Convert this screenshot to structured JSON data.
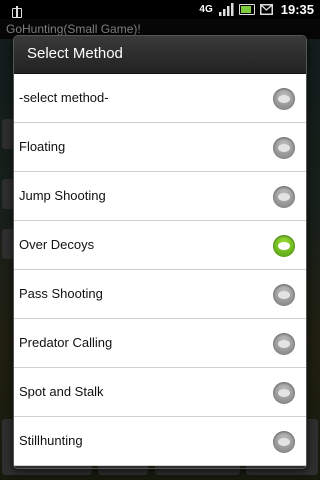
{
  "status_bar": {
    "network": "4G",
    "time": "19:35",
    "battery_level": 0.7
  },
  "background": {
    "app_title": "GoHunting(Small Game)!"
  },
  "dialog": {
    "title": "Select Method",
    "options": [
      {
        "label": "-select method-",
        "selected": false
      },
      {
        "label": "Floating",
        "selected": false
      },
      {
        "label": "Jump Shooting",
        "selected": false
      },
      {
        "label": "Over Decoys",
        "selected": true
      },
      {
        "label": "Pass Shooting",
        "selected": false
      },
      {
        "label": "Predator Calling",
        "selected": false
      },
      {
        "label": "Spot and Stalk",
        "selected": false
      },
      {
        "label": "Stillhunting",
        "selected": false
      }
    ]
  },
  "colors": {
    "selected_radio": "#6cc21c",
    "unselected_radio": "#9a9a9a",
    "dialog_header": "#2c2c2c"
  }
}
